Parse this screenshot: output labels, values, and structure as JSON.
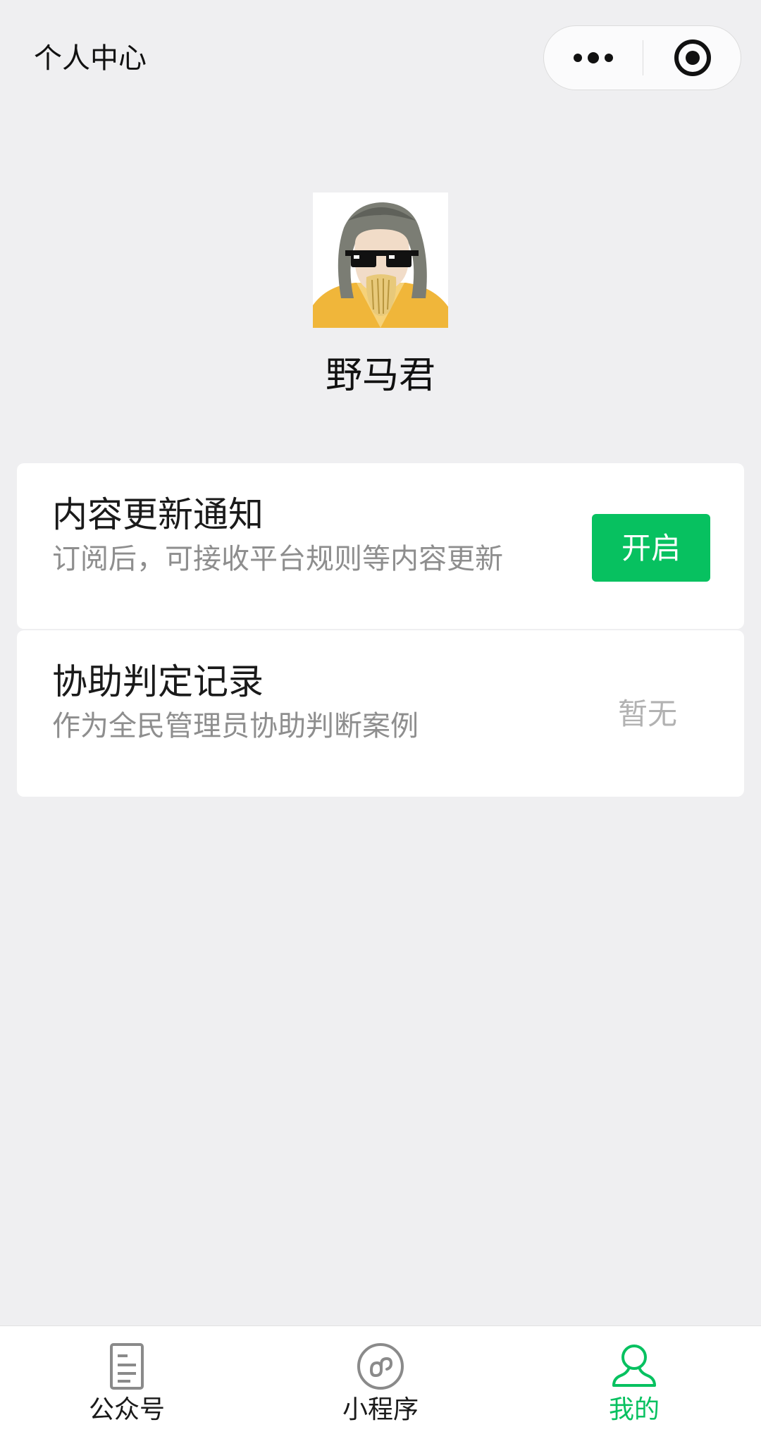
{
  "header": {
    "title": "个人中心",
    "more_icon": "more-dots-icon",
    "close_icon": "target-close-icon"
  },
  "profile": {
    "nickname": "野马君",
    "avatar_icon": "cartoon-avatar-with-sunglasses"
  },
  "cards": {
    "notify": {
      "title": "内容更新通知",
      "subtitle": "订阅后，可接收平台规则等内容更新",
      "button_label": "开启"
    },
    "assist": {
      "title": "协助判定记录",
      "subtitle": "作为全民管理员协助判断案例",
      "status": "暂无"
    }
  },
  "tabbar": {
    "tabs": [
      {
        "label": "公众号",
        "icon": "document-icon",
        "active": false
      },
      {
        "label": "小程序",
        "icon": "mini-program-icon",
        "active": false
      },
      {
        "label": "我的",
        "icon": "user-icon",
        "active": true
      }
    ]
  },
  "colors": {
    "accent": "#07c160",
    "background": "#efeff1",
    "secondary_text": "#8e8e8e",
    "muted_text": "#b2b2b2"
  }
}
